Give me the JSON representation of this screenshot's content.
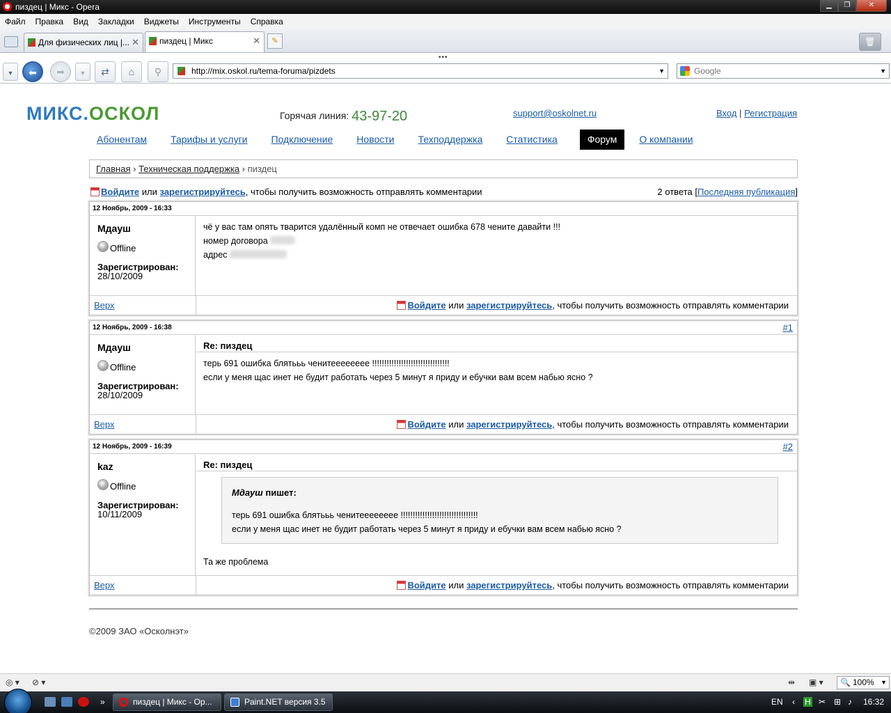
{
  "window": {
    "title": "пиздец | Микс - Opera"
  },
  "menu": [
    "Файл",
    "Правка",
    "Вид",
    "Закладки",
    "Виджеты",
    "Инструменты",
    "Справка"
  ],
  "tabs": [
    {
      "label": "Для физических лиц |..."
    },
    {
      "label": "пиздец | Микс"
    }
  ],
  "nav": {
    "url": "http://mix.oskol.ru/tema-foruma/pizdets",
    "search_placeholder": "Google"
  },
  "site": {
    "logo_part1": "МИКС.",
    "logo_part2": "ОСКОЛ",
    "hotline_label": "Горячая линия:",
    "hotline_number": "43-97-20",
    "support_email": "support@oskolnet.ru",
    "login": "Вход",
    "register": "Регистрация",
    "auth_sep": "|",
    "menu": [
      "Абонентам",
      "Тарифы и услуги",
      "Подключение",
      "Новости",
      "Техподдержка",
      "Статистика",
      "Форум",
      "О компании"
    ]
  },
  "breadcrumb": {
    "home": "Главная",
    "sep": "›",
    "section": "Техническая поддержка",
    "current": "пиздец"
  },
  "login_prompt": {
    "login": "Войдите",
    "or": "или",
    "register": "зарегистрируйтесь",
    "rest": ", чтобы получить возможность отправлять комментарии"
  },
  "answers": {
    "count_text": "2 ответа [",
    "last_link": "Последняя публикация",
    "close": "]"
  },
  "posts": [
    {
      "date": "12 Ноябрь, 2009 - 16:33",
      "number": "",
      "author": "Мдауш",
      "status": "Offline",
      "reg_label": "Зарегистрирован:",
      "reg_date": "28/10/2009",
      "subject": "",
      "lines": [
        "чё у вас там опять тварится удалённый комп не отвечает ошибка 678 чените давайти !!!",
        "номер договора",
        "адрес"
      ],
      "top_link": "Верх"
    },
    {
      "date": "12 Ноябрь, 2009 - 16:38",
      "number": "#1",
      "author": "Мдауш",
      "status": "Offline",
      "reg_label": "Зарегистрирован:",
      "reg_date": "28/10/2009",
      "subject": "Re: пиздец",
      "lines": [
        "терь 691 ошибка блятььь ченитееееееее !!!!!!!!!!!!!!!!!!!!!!!!!!!!!!!!",
        "если у меня щас инет не будит работать через 5 минут я приду и ебучки вам всем набью ясно ?"
      ],
      "top_link": "Верх"
    },
    {
      "date": "12 Ноябрь, 2009 - 16:39",
      "number": "#2",
      "author": "kaz",
      "status": "Offline",
      "reg_label": "Зарегистрирован:",
      "reg_date": "10/11/2009",
      "subject": "Re: пиздец",
      "quote_author": "Мдауш",
      "quote_writes": "пишет:",
      "quote_lines": [
        "терь 691 ошибка блятььь ченитееееееее !!!!!!!!!!!!!!!!!!!!!!!!!!!!!!!!",
        "если у меня щас инет не будит работать через 5 минут я приду и ебучки вам всем набью ясно ?"
      ],
      "reply": "Та же проблема",
      "top_link": "Верх"
    }
  ],
  "footer": {
    "copyright": "©2009 ЗАО «Осколнэт»"
  },
  "statusbar": {
    "zoom": "100%"
  },
  "taskbar": {
    "buttons": [
      "пиздец | Микс - Ор...",
      "Paint.NET версия 3.5"
    ],
    "lang": "EN",
    "time": "16:32"
  }
}
